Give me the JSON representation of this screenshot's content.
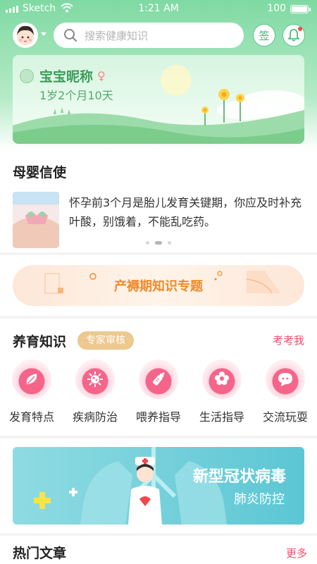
{
  "status_bar": {
    "carrier": "Sketch",
    "time": "1:21 AM",
    "battery": "100"
  },
  "header": {
    "search_placeholder": "搜索健康知识",
    "sign_label": "签"
  },
  "baby": {
    "name": "宝宝昵称",
    "gender_symbol": "♀",
    "age": "1岁2个月10天"
  },
  "messenger": {
    "title": "母婴信使",
    "text": "怀孕前3个月是胎儿发育关键期，你应及时补充叶酸，别饿着，不能乱吃药。"
  },
  "topic_banner": {
    "text": "产褥期知识专题"
  },
  "knowledge": {
    "title": "养育知识",
    "badge": "专家审核",
    "quiz_link": "考考我",
    "categories": [
      {
        "label": "发育特点",
        "icon": "leaf-icon"
      },
      {
        "label": "疾病防治",
        "icon": "virus-icon"
      },
      {
        "label": "喂养指导",
        "icon": "bottle-icon"
      },
      {
        "label": "生活指导",
        "icon": "flower-icon"
      },
      {
        "label": "交流玩耍",
        "icon": "chat-bubble-icon"
      }
    ]
  },
  "covid_banner": {
    "title": "新型冠状病毒",
    "subtitle": "肺炎防控"
  },
  "hot_articles": {
    "title": "热门文章",
    "more_link": "更多"
  },
  "colors": {
    "brand_green": "#56c98a",
    "accent_pink": "#f04f6b",
    "accent_orange": "#f08a2a"
  }
}
